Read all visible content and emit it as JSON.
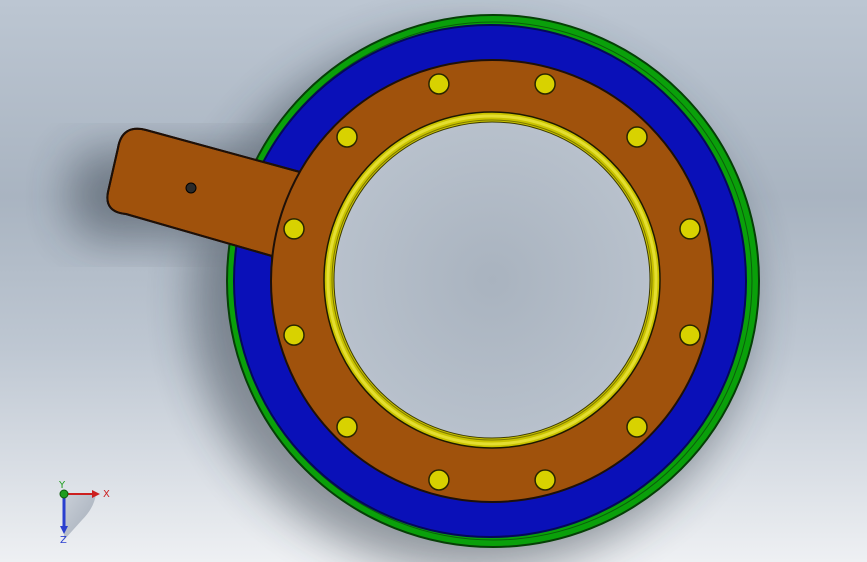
{
  "viewport": {
    "background_top": "#bcc6d2",
    "background_bottom": "#eef0f3"
  },
  "part": {
    "outer_ring_color": "#0aa00a",
    "blue_ring_color": "#0a10b8",
    "flange_color": "#a0520c",
    "bolt_color": "#d8d200",
    "bolt_count": 12,
    "tab_hole_color": "#2a2a2a"
  },
  "triad": {
    "x_label": "X",
    "y_label": "Y",
    "z_label": "Z",
    "x_color": "#cc1f1f",
    "y_color": "#1f9d1f",
    "z_color": "#2a3fcf"
  }
}
